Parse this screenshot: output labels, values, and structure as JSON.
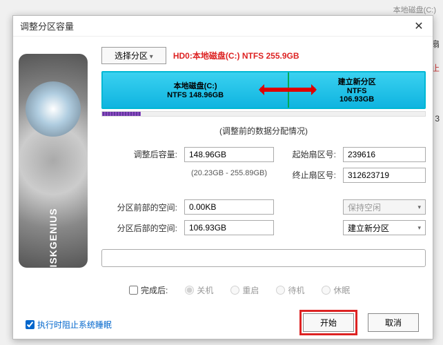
{
  "bg": {
    "top": "本地磁盘(C:)",
    "right1": "道扇",
    "right2": "终止",
    "right3": "3"
  },
  "dialog": {
    "title": "调整分区容量",
    "select_partition": "选择分区",
    "disk_info": "HD0:本地磁盘(C:) NTFS 255.9GB",
    "partitions": {
      "a": {
        "title": "本地磁盘(C:)",
        "sub": "NTFS 148.96GB"
      },
      "b": {
        "title": "建立新分区",
        "sub": "NTFS",
        "size": "106.93GB"
      }
    },
    "pre_label": "(调整前的数据分配情况)",
    "fields": {
      "after_size_label": "调整后容量:",
      "after_size": "148.96GB",
      "range": "(20.23GB - 255.89GB)",
      "start_sector_label": "起始扇区号:",
      "start_sector": "239616",
      "end_sector_label": "终止扇区号:",
      "end_sector": "312623719",
      "space_before_label": "分区前部的空间:",
      "space_before": "0.00KB",
      "space_before_opt": "保持空闲",
      "space_after_label": "分区后部的空间:",
      "space_after": "106.93GB",
      "space_after_opt": "建立新分区"
    },
    "finish": {
      "label": "完成后:",
      "shutdown": "关机",
      "restart": "重启",
      "standby": "待机",
      "hibernate": "休眠"
    },
    "buttons": {
      "start": "开始",
      "cancel": "取消"
    },
    "sleep_prevent": "执行时阻止系统睡眠"
  }
}
